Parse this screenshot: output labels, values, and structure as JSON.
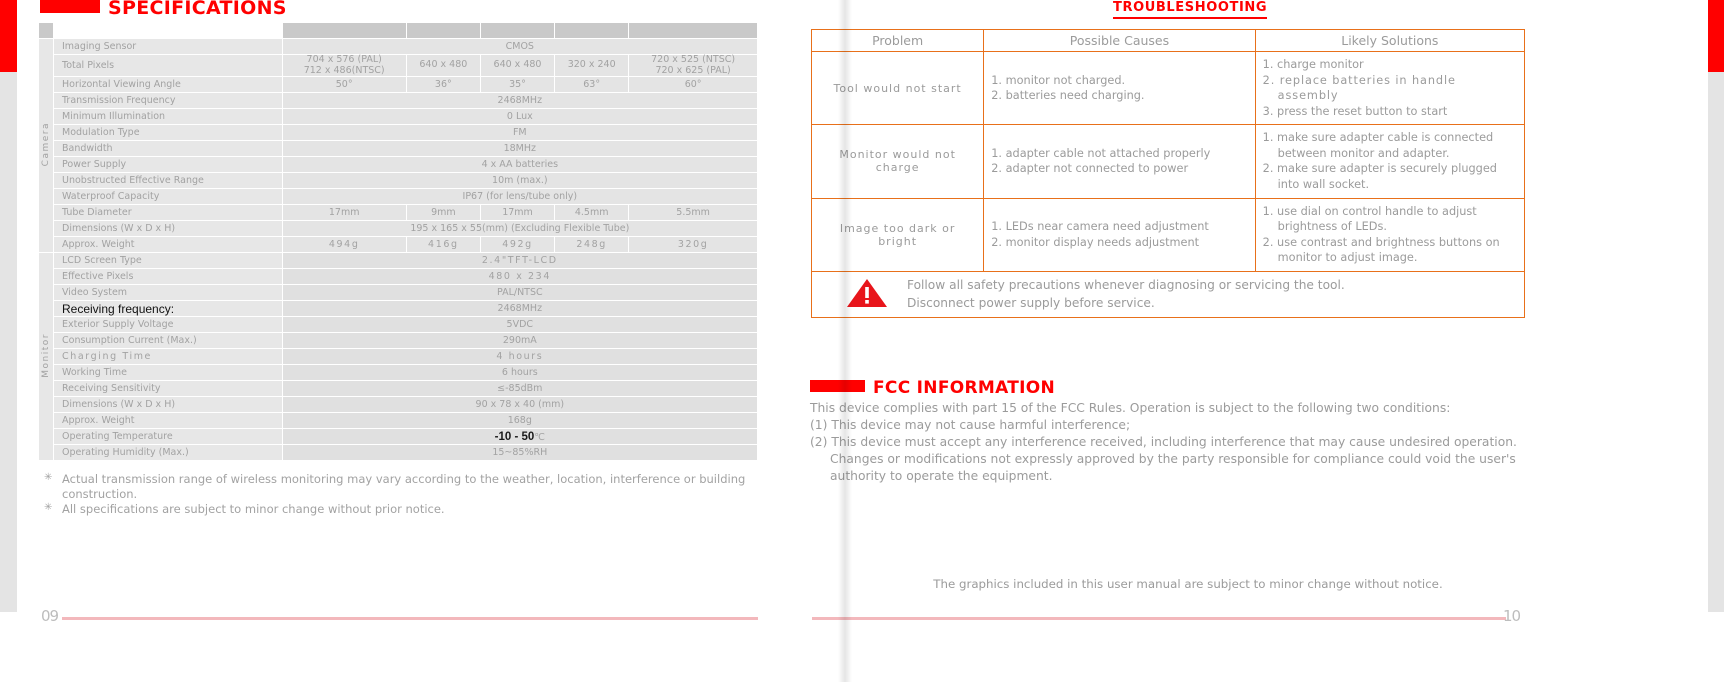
{
  "sections": {
    "specifications_title": "SPECIFICATIONS",
    "troubleshooting_title": "TROUBLESHOOTING",
    "fcc_title": "FCC INFORMATION"
  },
  "colors": {
    "brand_red": "#ff0000",
    "table_border_orange": "#e8701a",
    "footer_rule_pink": "#f3b8bc",
    "table_cell_grey": "#e4e4e4",
    "table_header_grey": "#c9c9c9"
  },
  "spec_table": {
    "category_camera": "Camera",
    "category_monitor": "Monitor",
    "rows": [
      {
        "label": "Imaging Sensor",
        "span": true,
        "value": "CMOS"
      },
      {
        "label": "Total Pixels",
        "span": false,
        "values": [
          "704 x 576 (PAL)\n712 x 486(NTSC)",
          "640 x 480",
          "640 x 480",
          "320 x 240",
          "720 x 525 (NTSC)\n720 x 625 (PAL)"
        ]
      },
      {
        "label": "Horizontal Viewing Angle",
        "span": false,
        "values": [
          "50°",
          "36°",
          "35°",
          "63°",
          "60°"
        ]
      },
      {
        "label": "Transmission Frequency",
        "span": true,
        "value": "2468MHz"
      },
      {
        "label": "Minimum Illumination",
        "span": true,
        "value": "0 Lux"
      },
      {
        "label": "Modulation Type",
        "span": true,
        "value": "FM"
      },
      {
        "label": "Bandwidth",
        "span": true,
        "value": "18MHz"
      },
      {
        "label": "Power Supply",
        "span": true,
        "value": "4 x AA batteries"
      },
      {
        "label": "Unobstructed Effective Range",
        "span": true,
        "value": "10m (max.)"
      },
      {
        "label": "Waterproof Capacity",
        "span": true,
        "value": "IP67 (for lens/tube only)"
      },
      {
        "label": "Tube Diameter",
        "span": false,
        "values": [
          "17mm",
          "9mm",
          "17mm",
          "4.5mm",
          "5.5mm"
        ]
      },
      {
        "label": "Dimensions (W x D x H)",
        "span": true,
        "value": "195 x 165 x 55(mm) (Excluding Flexible Tube)"
      },
      {
        "label": "Approx. Weight",
        "span": false,
        "values": [
          "494g",
          "416g",
          "492g",
          "248g",
          "320g"
        ]
      },
      {
        "label": "LCD Screen Type",
        "span": true,
        "value": "2.4\"TFT-LCD"
      },
      {
        "label": "Effective Pixels",
        "span": true,
        "value": "480 x 234"
      },
      {
        "label": "Video System",
        "span": true,
        "value": "PAL/NTSC"
      },
      {
        "label": "Receiving frequency:",
        "span": true,
        "value": "2468MHz",
        "label_highlight": true
      },
      {
        "label": "Exterior Supply Voltage",
        "span": true,
        "value": "5VDC"
      },
      {
        "label": "Consumption Current (Max.)",
        "span": true,
        "value": "290mA"
      },
      {
        "label": "Charging Time",
        "span": true,
        "value": "4 hours"
      },
      {
        "label": "Working Time",
        "span": true,
        "value": "6 hours"
      },
      {
        "label": "Receiving Sensitivity",
        "span": true,
        "value": "≤-85dBm"
      },
      {
        "label": "Dimensions (W x D x H)",
        "span": true,
        "value": "90 x 78 x 40 (mm)"
      },
      {
        "label": "Approx. Weight",
        "span": true,
        "value": "168g"
      },
      {
        "label": "Operating Temperature",
        "span": true,
        "value": "-10 - 50",
        "value_unit": "℃",
        "value_highlight": true
      },
      {
        "label": "Operating Humidity (Max.)",
        "span": true,
        "value": "15~85%RH"
      }
    ]
  },
  "footnotes": [
    "Actual transmission range of wireless monitoring may vary according to the weather, location, interference or building construction.",
    "All specifications are subject to minor change without prior notice."
  ],
  "troubleshooting": {
    "headers": [
      "Problem",
      "Possible Causes",
      "Likely Solutions"
    ],
    "rows": [
      {
        "problem": "Tool would not start",
        "causes": [
          "1. monitor not charged.",
          "2. batteries need charging."
        ],
        "solutions": [
          "1. charge monitor",
          "2. replace batteries in handle assembly",
          "3. press the reset button to start"
        ]
      },
      {
        "problem": "Monitor would not charge",
        "causes": [
          "1. adapter cable not attached properly",
          "2. adapter not connected to power"
        ],
        "solutions": [
          "1. make sure adapter cable is connected between monitor and adapter.",
          "2. make sure adapter is securely plugged into wall socket."
        ]
      },
      {
        "problem": "Image too dark or bright",
        "causes": [
          "1. LEDs near camera need adjustment",
          "2. monitor display needs adjustment"
        ],
        "solutions": [
          "1. use dial on control handle to adjust brightness of LEDs.",
          "2. use contrast and brightness buttons on monitor to adjust image."
        ]
      }
    ],
    "warning": {
      "icon": "warning-triangle",
      "line1": "Follow all safety precautions whenever diagnosing or servicing the tool.",
      "line2": "Disconnect power supply before service."
    }
  },
  "fcc": {
    "intro": "This device complies with part 15 of the FCC Rules. Operation is subject to the following two conditions:",
    "item1": "(1) This device may not cause harmful interference;",
    "item2": "(2) This device must accept any interference received, including interference that may cause undesired operation. Changes or modifications not expressly approved by the party responsible for compliance could void the user's authority to operate the equipment."
  },
  "graphics_note": "The graphics included in this user manual are subject to minor change without notice.",
  "footer": {
    "page_left": "09",
    "page_right": "10"
  }
}
